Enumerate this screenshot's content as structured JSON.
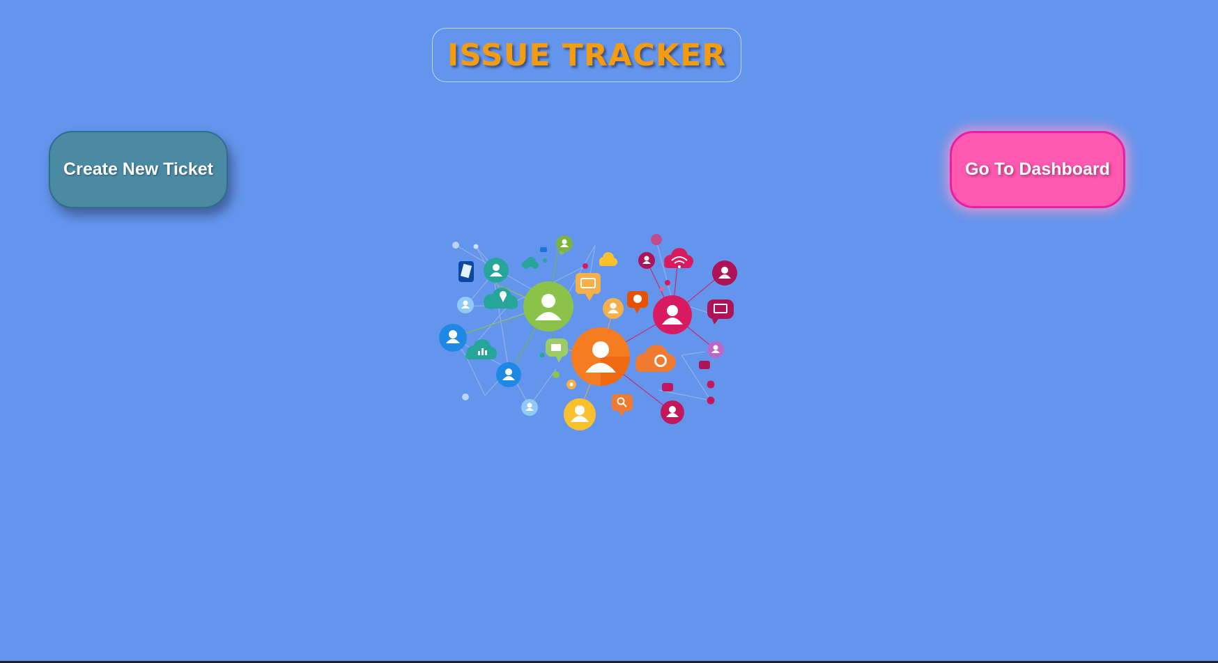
{
  "header": {
    "title": "ISSUE TRACKER"
  },
  "actions": {
    "create_label": "Create New Ticket",
    "dashboard_label": "Go To Dashboard"
  },
  "colors": {
    "background": "#6495ed",
    "title": "#f39c12",
    "create_button": "#4a8aa2",
    "dashboard_button": "#ff5ab0"
  },
  "illustration": {
    "icon": "social-network-illustration"
  }
}
